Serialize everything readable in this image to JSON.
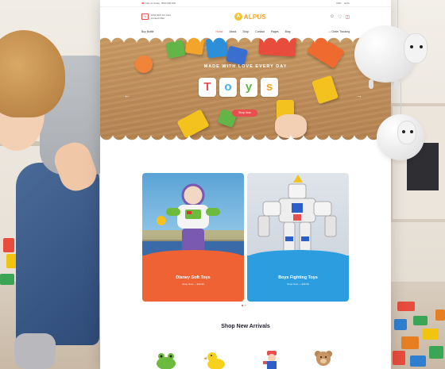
{
  "topbar": {
    "phone": "Call Us Today: 0500 000 000",
    "currency": "USD",
    "language": "ENG"
  },
  "header": {
    "promo_badge": "%",
    "promo_line1": "15% OFF For Kids",
    "promo_line2": "Limited Offer",
    "logo_mark": "A",
    "logo_text": "ALPUS"
  },
  "nav": {
    "category": "Buy Bottle",
    "links": [
      "Home",
      "About",
      "Shop",
      "Contact",
      "Pages",
      "Blog"
    ],
    "track": "Order Tracking"
  },
  "hero": {
    "tagline": "MADE WITH LOVE EVERY DAY",
    "letters": [
      "T",
      "o",
      "y",
      "s"
    ],
    "button": "Shop Now"
  },
  "cards": [
    {
      "title": "Disney Soft Toys",
      "sub": "Shop Now — $39.99",
      "accent": "#ef6233"
    },
    {
      "title": "Boys Fighting Toys",
      "sub": "Shop Now — $49.99",
      "accent": "#2c9ee0"
    }
  ],
  "section": {
    "title": "Shop New Arrivals"
  },
  "colors": {
    "accent": "#e94e4e",
    "logo": "#f0a52a"
  }
}
